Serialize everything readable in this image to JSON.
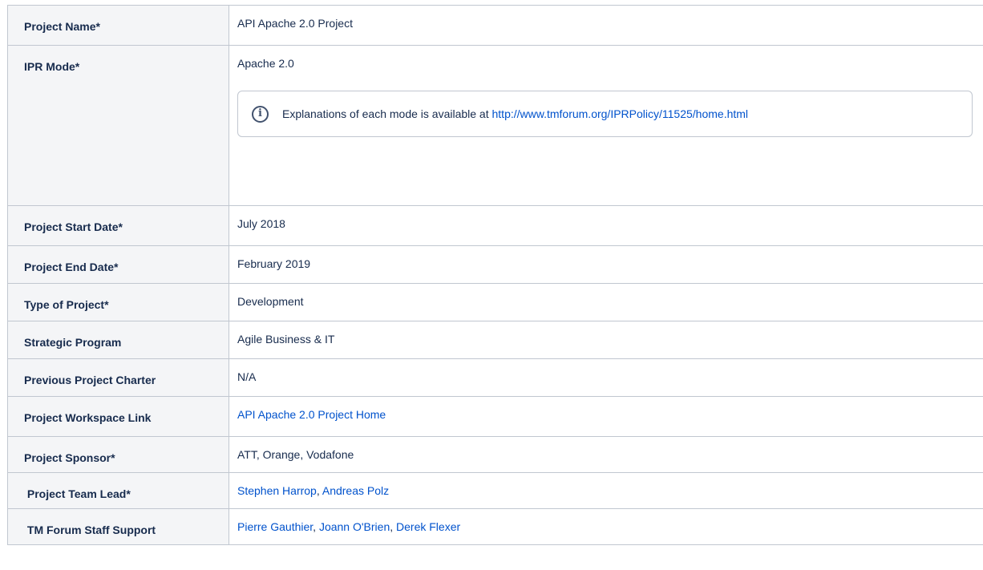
{
  "rows": [
    {
      "label": "Project Name*",
      "value": "API Apache 2.0 Project"
    },
    {
      "label": "IPR Mode*",
      "value": "Apache 2.0",
      "info": {
        "text": "Explanations of each mode is available at ",
        "link": "http://www.tmforum.org/IPRPolicy/11525/home.html"
      }
    },
    {
      "label": "Project Start Date*",
      "value": "July 2018"
    },
    {
      "label": "Project End Date*",
      "value": "February 2019"
    },
    {
      "label": "Type of Project*",
      "value": "Development"
    },
    {
      "label": "Strategic Program",
      "value": "Agile Business &  IT"
    },
    {
      "label": "Previous Project Charter",
      "value": "N/A"
    },
    {
      "label": "Project Workspace Link",
      "link": "API Apache 2.0 Project Home"
    },
    {
      "label": "Project Sponsor*",
      "value": "ATT, Orange, Vodafone"
    },
    {
      "label": " Project Team Lead*",
      "links": [
        "Stephen Harrop",
        "Andreas Polz"
      ]
    },
    {
      "label": " TM Forum Staff Support",
      "links": [
        "Pierre Gauthier",
        "Joann O'Brien",
        "Derek Flexer"
      ]
    }
  ],
  "separator": ", ",
  "colors": {
    "link": "#0052cc",
    "header_bg": "#f4f5f7",
    "border": "#c1c7d0"
  },
  "icons": {
    "info_panel": "info-icon"
  }
}
